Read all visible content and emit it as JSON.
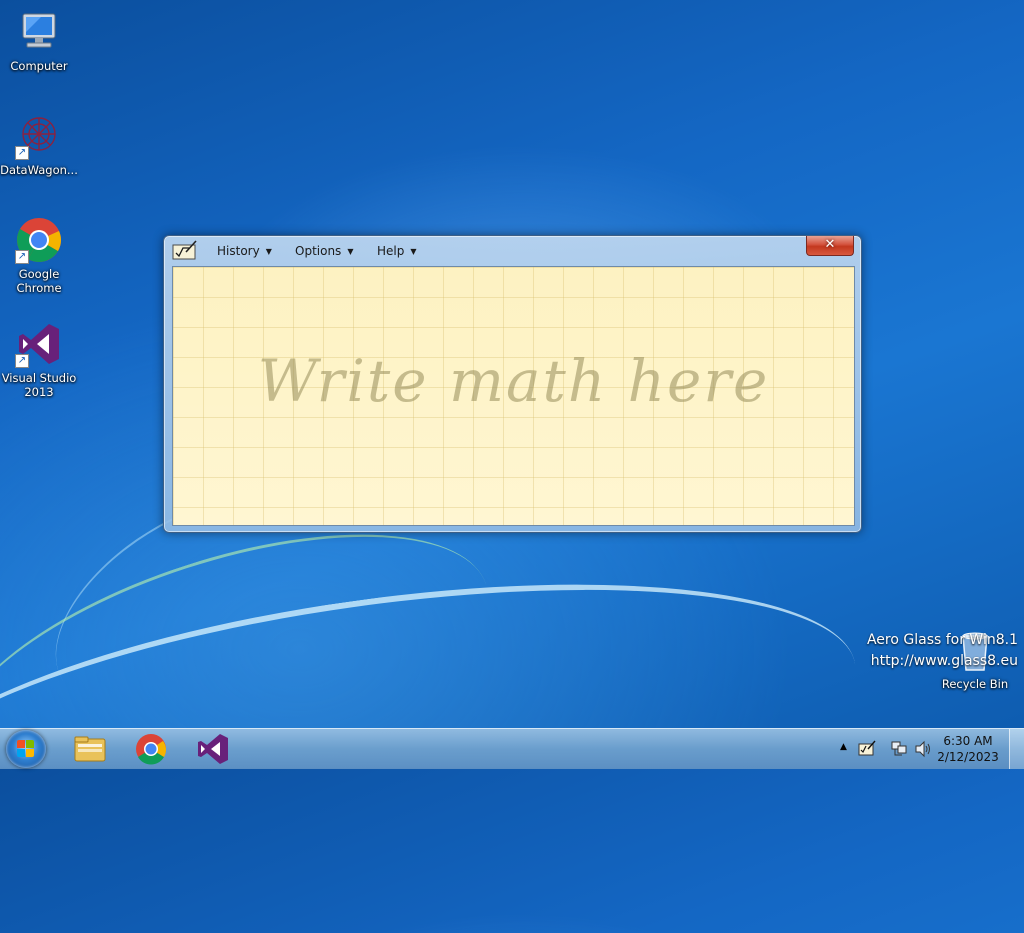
{
  "desktop": {
    "icons": [
      {
        "label": "Computer",
        "icon": "computer-icon"
      },
      {
        "label": "DataWagon...",
        "icon": "datawagon-icon"
      },
      {
        "label": "Google Chrome",
        "icon": "chrome-icon"
      },
      {
        "label": "Visual Studio 2013",
        "icon": "visual-studio-icon"
      },
      {
        "label": "Recycle Bin",
        "icon": "recycle-bin-icon"
      }
    ],
    "watermark": {
      "line1": "Aero Glass for Win8.1",
      "line2": "http://www.glass8.eu"
    }
  },
  "window": {
    "app": "Math Input Panel",
    "menus": [
      {
        "label": "History"
      },
      {
        "label": "Options"
      },
      {
        "label": "Help"
      }
    ],
    "close_label": "✕",
    "placeholder": "Write math here"
  },
  "taskbar": {
    "pinned": [
      {
        "icon": "file-explorer-icon"
      },
      {
        "icon": "chrome-icon"
      },
      {
        "icon": "visual-studio-icon"
      }
    ],
    "tray": {
      "overflow_arrow": "▲",
      "time": "6:30 AM",
      "date": "2/12/2023"
    }
  },
  "colors": {
    "desktop_blue": "#1467c4",
    "canvas_yellow": "#fdf3c6",
    "close_red": "#c3381f"
  }
}
